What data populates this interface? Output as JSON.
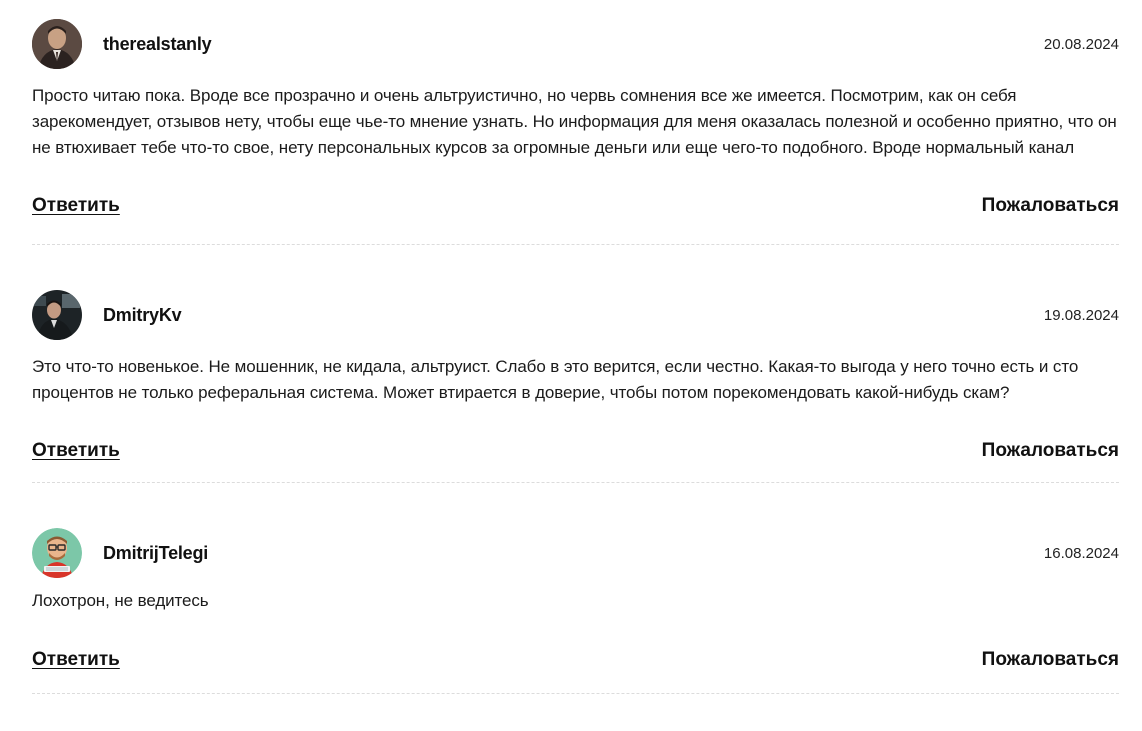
{
  "comments": [
    {
      "author": "therealstanly",
      "date": "20.08.2024",
      "avatar_icon": "user-photo-avatar",
      "text": "Просто читаю пока. Вроде все прозрачно и очень альтруистично, но червь сомнения все же имеется. Посмотрим, как он себя зарекомендует, отзывов нету, чтобы еще чье-то мнение узнать. Но информация для меня оказалась полезной и особенно приятно, что он не втюхивает тебе что-то свое, нету персональных курсов за огромные деньги или еще чего-то подобного. Вроде нормальный канал",
      "reply_label": "Ответить",
      "report_label": "Пожаловаться"
    },
    {
      "author": "DmitryKv",
      "date": "19.08.2024",
      "avatar_icon": "user-photo-avatar",
      "text": "Это что-то новенькое. Не мошенник, не кидала, альтруист. Слабо в это верится, если честно. Какая-то выгода у него точно есть и сто процентов не только реферальная система. Может втирается в доверие, чтобы потом порекомендовать какой-нибудь скам?",
      "reply_label": "Ответить",
      "report_label": "Пожаловаться"
    },
    {
      "author": "DmitrijTelegi",
      "date": "16.08.2024",
      "avatar_icon": "cartoon-avatar",
      "text": "Лохотрон, не ведитесь",
      "reply_label": "Ответить",
      "report_label": "Пожаловаться"
    }
  ],
  "colors": {
    "text": "#1b1b1b",
    "divider": "#dcdcdc",
    "avatar3_bg": "#7cc7a8",
    "avatar3_shirt": "#d8352a"
  }
}
